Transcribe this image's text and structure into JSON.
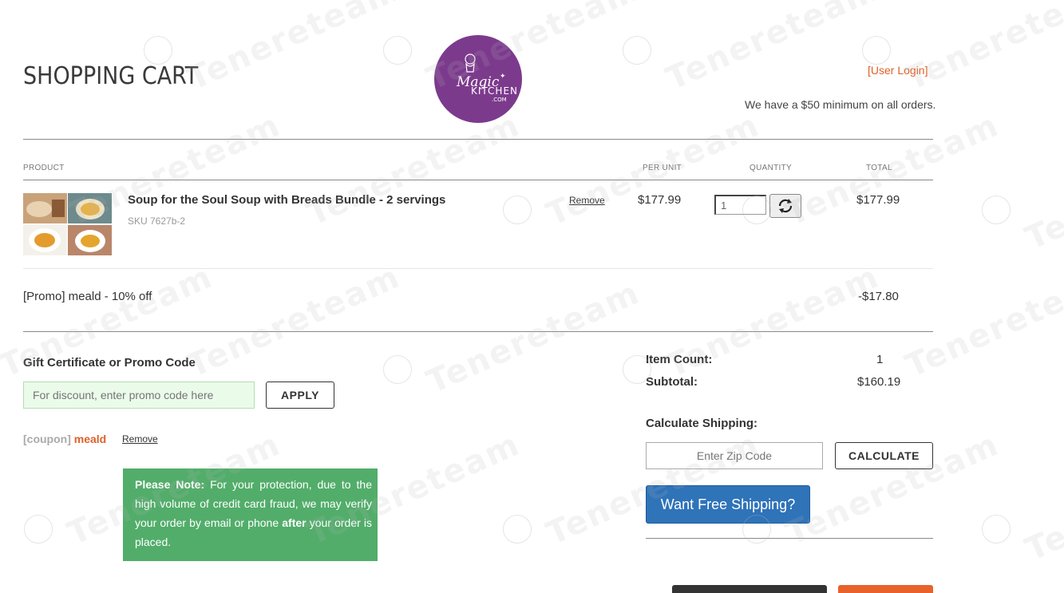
{
  "header": {
    "title": "SHOPPING CART",
    "logo_text": "Magic Kitchen .com",
    "login_link": "[User Login]",
    "minimum_note": "We have a $50 minimum on all orders."
  },
  "columns": {
    "product": "PRODUCT",
    "per_unit": "PER UNIT",
    "quantity": "QUANTITY",
    "total": "TOTAL"
  },
  "item": {
    "name": "Soup for the Soul Soup with Breads Bundle - 2 servings",
    "sku": "SKU 7627b-2",
    "remove": "Remove",
    "unit_price": "$177.99",
    "quantity": "1",
    "total": "$177.99"
  },
  "promo_line": {
    "label": "[Promo] meald - 10% off",
    "amount": "-$17.80"
  },
  "promo_section": {
    "label": "Gift Certificate or Promo Code",
    "placeholder": "For discount, enter promo code here",
    "apply": "APPLY",
    "coupon_tag": "[coupon]",
    "coupon_code": "meald",
    "remove": "Remove"
  },
  "note": {
    "bold_lead": "Please Note:",
    "text1": " For your protection, due to the high volume of credit card fraud, we may verify your order by email or phone ",
    "bold_after": "after",
    "text2": " your order is placed."
  },
  "summary": {
    "item_count_label": "Item Count:",
    "item_count": "1",
    "subtotal_label": "Subtotal:",
    "subtotal": "$160.19",
    "shipping_label": "Calculate Shipping:",
    "zip_placeholder": "Enter Zip Code",
    "calculate": "CALCULATE",
    "free_shipping": "Want Free Shipping?"
  },
  "watermark": "Tenereteam",
  "colors": {
    "accent": "#e0602a",
    "logo": "#7c3a8d",
    "note_bg": "#52ad6a",
    "primary_btn": "#2f73b9"
  }
}
